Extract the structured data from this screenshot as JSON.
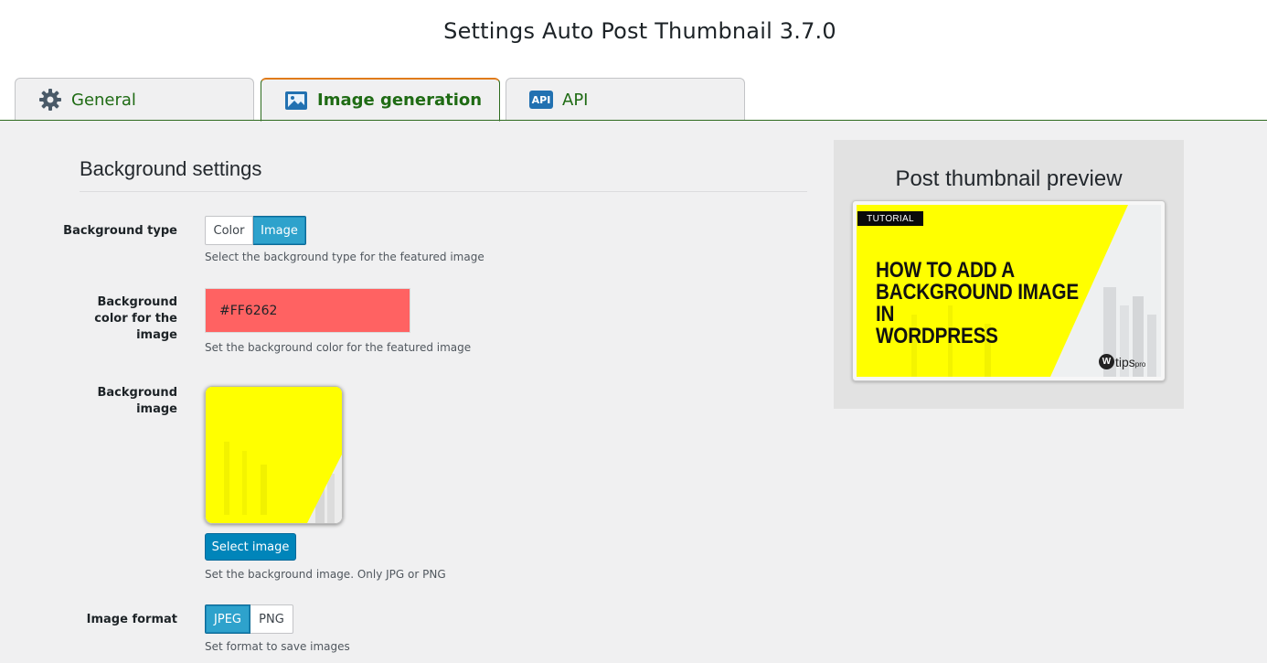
{
  "page": {
    "title": "Settings Auto Post Thumbnail 3.7.0"
  },
  "tabs": [
    {
      "label": "General",
      "icon": "gear-icon",
      "active": false
    },
    {
      "label": "Image generation",
      "icon": "image-icon",
      "active": true
    },
    {
      "label": "API",
      "icon": "api-icon",
      "badge": "API",
      "active": false
    }
  ],
  "section": {
    "title": "Background settings"
  },
  "background_type": {
    "label": "Background type",
    "options": [
      "Color",
      "Image"
    ],
    "selected": "Image",
    "description": "Select the background type for the featured image"
  },
  "background_color": {
    "label_line1": "Background",
    "label_line2": "color for the",
    "label_line3": "image",
    "value": "#FF6262",
    "description": "Set the background color for the featured image"
  },
  "background_image": {
    "label_line1": "Background",
    "label_line2": "image",
    "button_label": "Select image",
    "description": "Set the background image. Only JPG or PNG"
  },
  "image_format": {
    "label": "Image format",
    "options": [
      "JPEG",
      "PNG"
    ],
    "selected": "JPEG",
    "description": "Set format to save images"
  },
  "preview": {
    "title": "Post thumbnail preview",
    "tag": "TUTORIAL",
    "headline_line1": "HOW TO ADD A",
    "headline_line2": "BACKGROUND IMAGE IN",
    "headline_line3": "WORDPRESS",
    "logo_mark": "W",
    "logo_text": "tips",
    "logo_suffix": "pro"
  },
  "colors": {
    "accent_green": "#1f6b14",
    "accent_orange": "#e07b1a",
    "selected_blue": "#2ea2cc",
    "button_blue": "#0085ba",
    "swatch": "#FF6262",
    "preview_yellow": "#ffff00"
  }
}
